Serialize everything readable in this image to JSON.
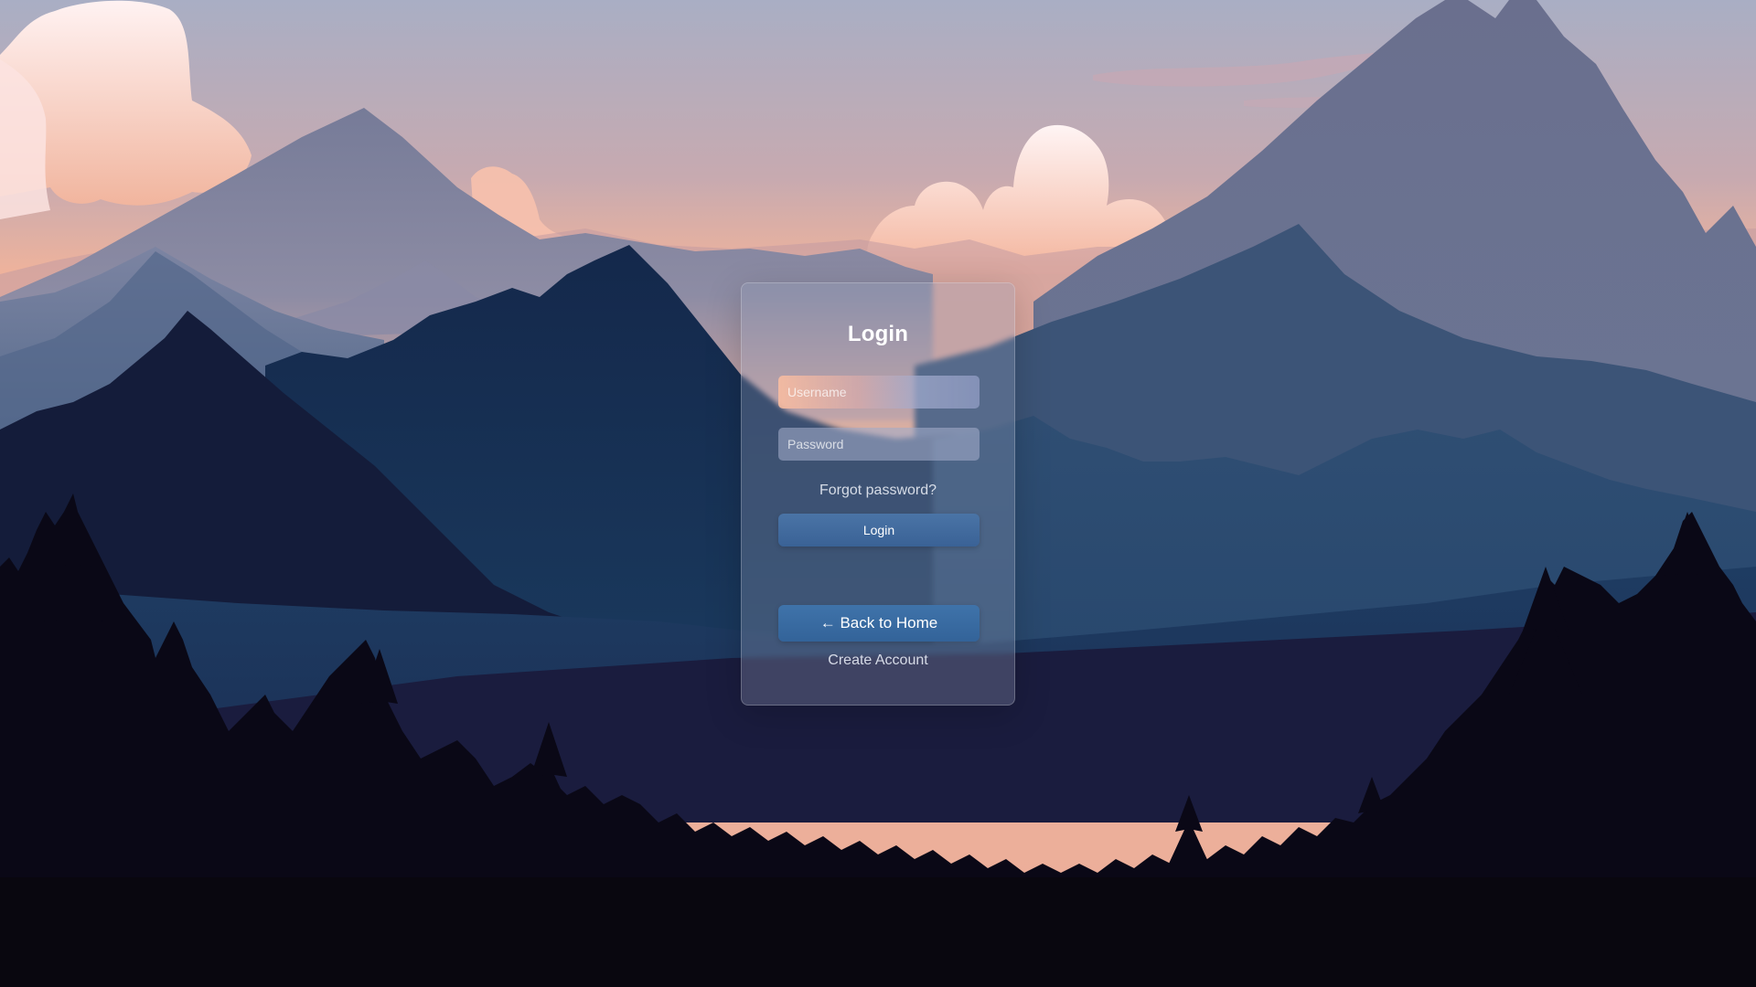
{
  "login_card": {
    "title": "Login",
    "username_placeholder": "Username",
    "password_placeholder": "Password",
    "forgot_password": "Forgot password?",
    "login_button": "Login",
    "back_home_button": "← Back to Home",
    "create_account": "Create Account"
  },
  "background": {
    "theme": "mountain-sunset-landscape",
    "colors": {
      "sky_top": "#a9aec4",
      "sky_bottom": "#f3b39a",
      "far_mountain": "#6e7592",
      "mid_mountain": "#2d4d72",
      "near_mountain": "#13264a",
      "forest": "#0a0816"
    }
  }
}
